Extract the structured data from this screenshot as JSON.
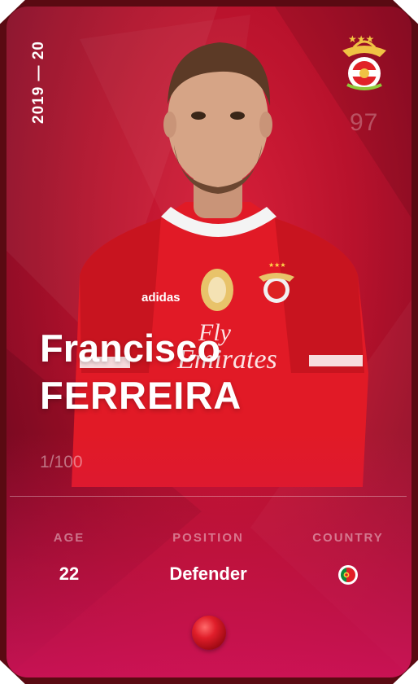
{
  "card": {
    "season": "2019 — 20",
    "rating": "97",
    "player": {
      "first_name": "Francisco",
      "last_name": "FERREIRA"
    },
    "serial": "1/100",
    "stats": {
      "age_label": "AGE",
      "age_value": "22",
      "position_label": "POSITION",
      "position_value": "Defender",
      "country_label": "COUNTRY",
      "country_flag": "portugal-flag-icon"
    },
    "club_crest": "benfica-crest-icon",
    "jersey_text": "Fly Emirates",
    "jersey_brand": "adidas"
  },
  "colors": {
    "card_red": "#b8122c",
    "card_dark": "#5a0a12",
    "card_pink": "#d6145c"
  }
}
